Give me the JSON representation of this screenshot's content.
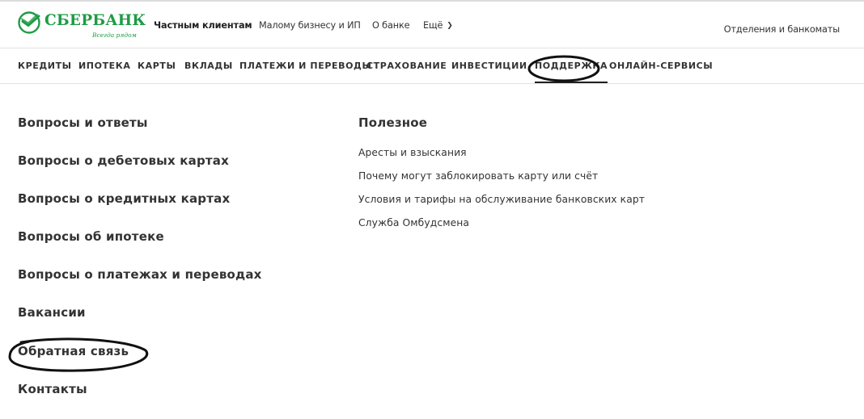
{
  "header": {
    "logo": {
      "name": "СБЕРБАНК",
      "tagline": "Всегда рядом"
    },
    "topnav": [
      {
        "label": "Частным клиентам",
        "active": true
      },
      {
        "label": "Малому бизнесу и ИП"
      },
      {
        "label": "О банке"
      },
      {
        "label": "Ещё",
        "dropdown": true,
        "icon": "chevron-down-icon"
      }
    ],
    "top_right_link": "Отделения и банкоматы"
  },
  "mainnav": [
    {
      "label": "КРЕДИТЫ"
    },
    {
      "label": "ИПОТЕКА"
    },
    {
      "label": "КАРТЫ"
    },
    {
      "label": "ВКЛАДЫ"
    },
    {
      "label": "ПЛАТЕЖИ И ПЕРЕВОДЫ"
    },
    {
      "label": "СТРАХОВАНИЕ"
    },
    {
      "label": "ИНВЕСТИЦИИ"
    },
    {
      "label": "ПОДДЕРЖКА",
      "active": true,
      "circled": true
    },
    {
      "label": "ОНЛАЙН-СЕРВИСЫ"
    }
  ],
  "support_menu": {
    "main_items": [
      {
        "label": "Вопросы и ответы"
      },
      {
        "label": "Вопросы о дебетовых картах"
      },
      {
        "label": "Вопросы о кредитных картах"
      },
      {
        "label": "Вопросы об ипотеке"
      },
      {
        "label": "Вопросы о платежах и переводах"
      },
      {
        "label": "Вакансии"
      },
      {
        "label": "Обратная связь",
        "circled": true
      },
      {
        "label": "Контакты"
      }
    ],
    "useful_heading": "Полезное",
    "useful_items": [
      {
        "label": "Аресты и взыскания"
      },
      {
        "label": "Почему могут заблокировать карту или счёт"
      },
      {
        "label": "Условия и тарифы на обслуживание банковских карт"
      },
      {
        "label": "Служба Омбудсмена"
      }
    ]
  },
  "colors": {
    "brand_green": "#1f9b45",
    "text": "#333333",
    "annotation": "#111111"
  }
}
